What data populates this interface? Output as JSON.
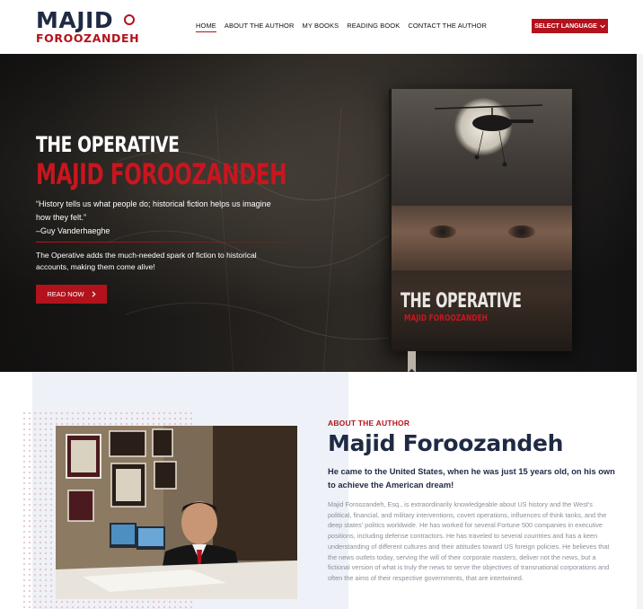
{
  "header": {
    "logo_top": "MAJID",
    "logo_bottom": "FOROOZANDEH",
    "nav": [
      {
        "label": "HOME",
        "active": true
      },
      {
        "label": "ABOUT THE AUTHOR",
        "active": false
      },
      {
        "label": "MY BOOKS",
        "active": false
      },
      {
        "label": "READING BOOK",
        "active": false
      },
      {
        "label": "CONTACT THE AUTHOR",
        "active": false
      }
    ],
    "language_button": "SELECT LANGUAGE",
    "language_icon": "chevron-down-icon"
  },
  "hero": {
    "title": "THE OPERATIVE",
    "subtitle": "MAJID FOROOZANDEH",
    "quote_line1": "“History tells us what people do; historical fiction helps us imagine how they felt.”",
    "quote_line2": "–Guy Vanderhaeghe",
    "description": "The Operative adds the much-needed spark of fiction to historical accounts, making them come alive!",
    "cta_label": "READ NOW",
    "cta_icon": "chevron-right-icon",
    "book_title": "THE OPERATIVE",
    "book_author": "MAJID FOROOZANDEH"
  },
  "about": {
    "label": "ABOUT THE AUTHOR",
    "name": "Majid Foroozandeh",
    "lead": "He came to the United States, when he was just 15 years old, on his own to achieve the American dream!",
    "body": "Majid Foroozandeh, Esq., is extraordinarily knowledgeable about US history and the West's political, financial, and military interventions, covert operations, influences of think tanks, and the deep states' politics worldwide. He has worked for several Fortune 500 companies in executive positions, including defense contractors. He has traveled to several countries and has a keen understanding of different cultures and their attitudes toward US foreign policies. He believes that the news outlets today, serving the will of their corporate masters, deliver not the news, but a fictional version of what is truly the news to serve the objectives of transnational corporations and often the aims of their respective governments, that are intertwined."
  },
  "colors": {
    "brand_red": "#b3121c",
    "navy": "#1f2a44"
  }
}
